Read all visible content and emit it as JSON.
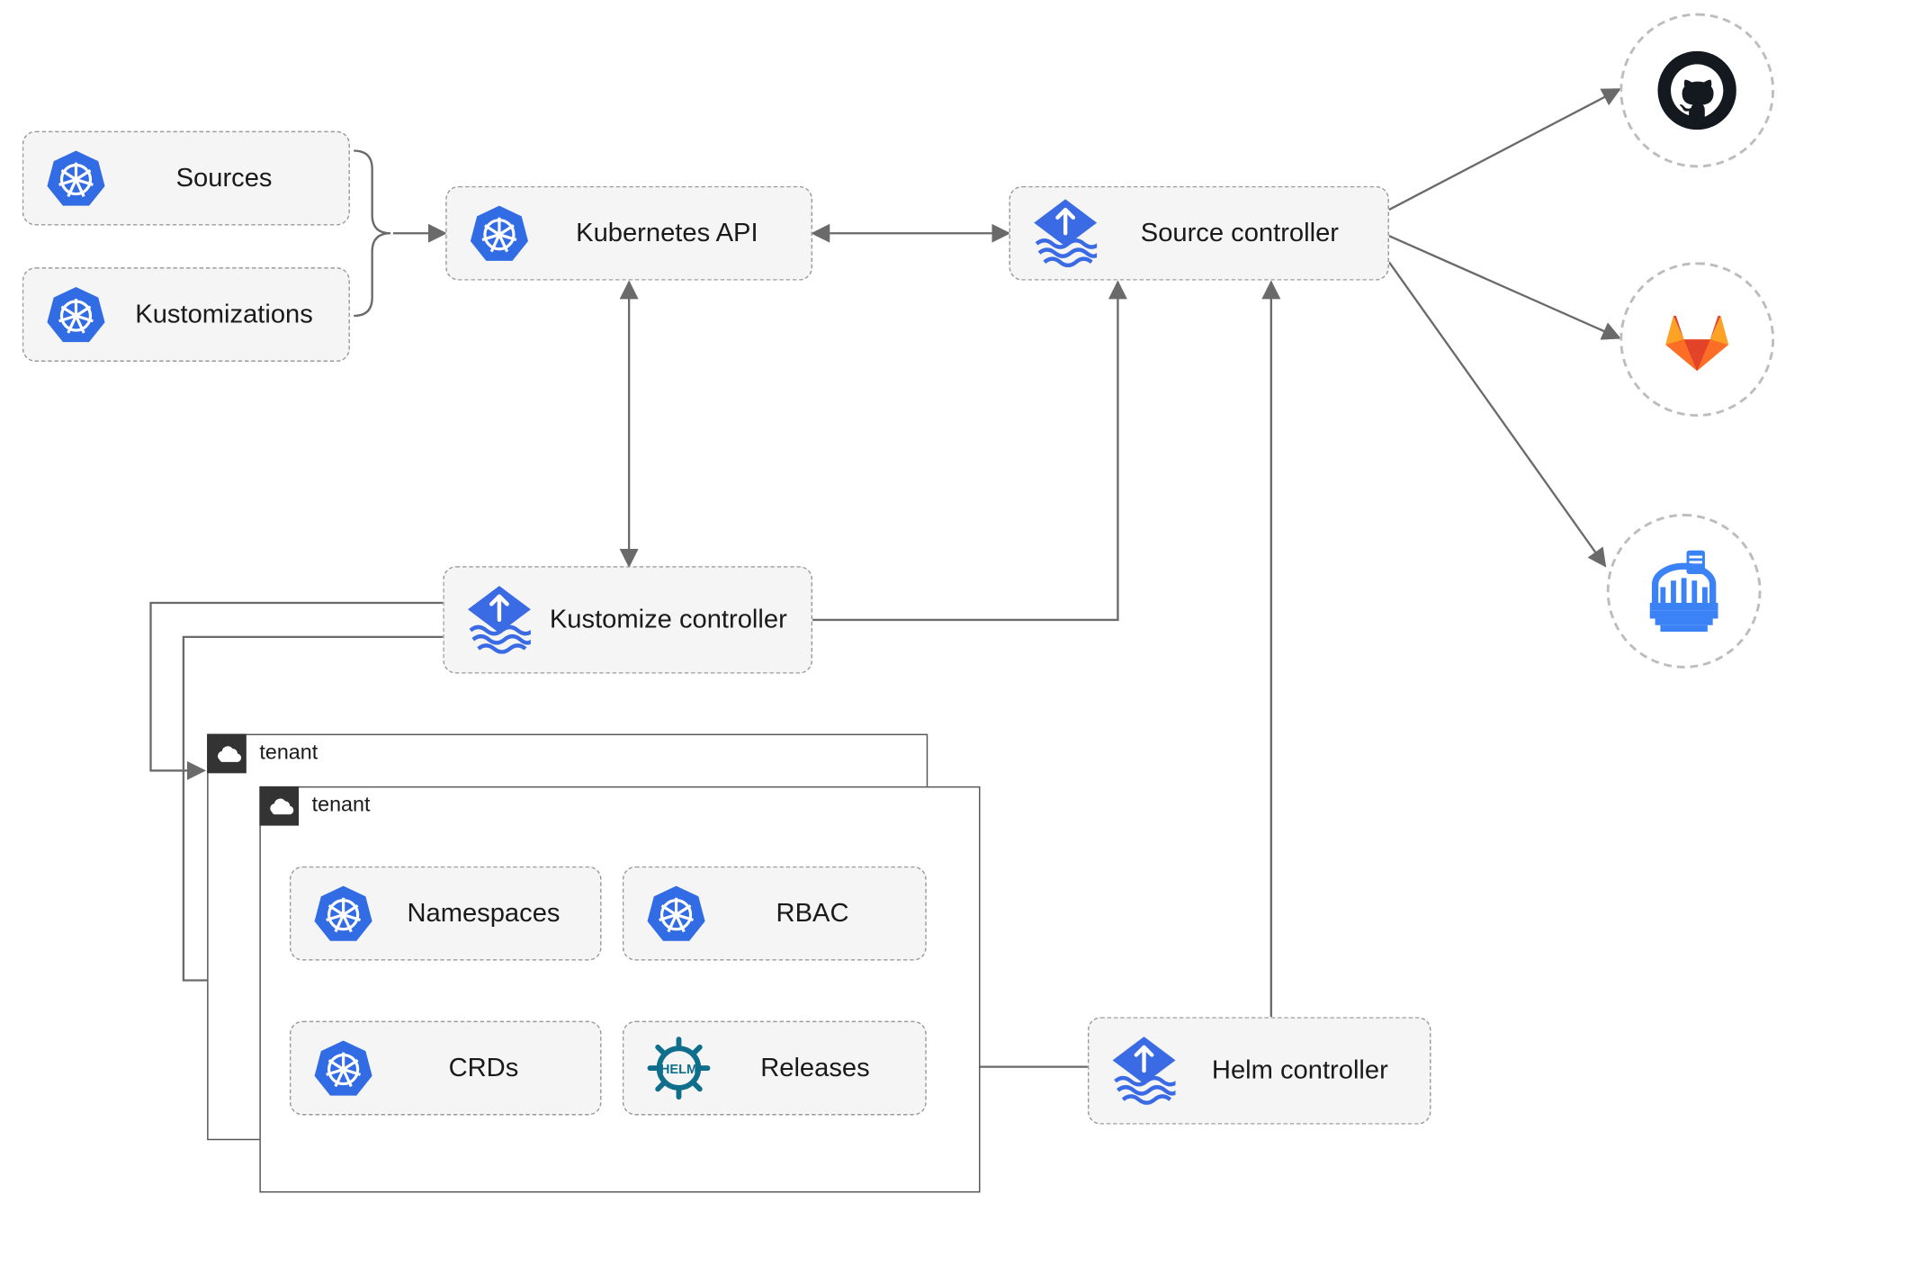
{
  "nodes": {
    "sources": "Sources",
    "kustomizations": "Kustomizations",
    "k8s_api": "Kubernetes API",
    "source_controller": "Source controller",
    "kustomize_controller": "Kustomize controller",
    "helm_controller": "Helm controller",
    "namespaces": "Namespaces",
    "rbac": "RBAC",
    "crds": "CRDs",
    "releases": "Releases"
  },
  "tenant_label": "tenant",
  "external": {
    "github": "github-icon",
    "gitlab": "gitlab-icon",
    "harbor": "harbor-icon"
  },
  "colors": {
    "node_bg": "#f5f5f5",
    "edge": "#6a6a6a",
    "k8s_blue": "#326ce5",
    "flux_blue": "#3a6be5",
    "helm_teal": "#0f6e8b",
    "github": "#14191f",
    "gitlab_orange": "#fc6d26",
    "gitlab_deep": "#e24329",
    "harbor_blue": "#3b82f6"
  },
  "edges": [
    {
      "from": "sources-kustomizations-brace",
      "to": "k8s_api",
      "type": "arrow"
    },
    {
      "from": "k8s_api",
      "to": "source_controller",
      "type": "double"
    },
    {
      "from": "k8s_api",
      "to": "kustomize_controller",
      "type": "double"
    },
    {
      "from": "kustomize_controller",
      "to": "source_controller",
      "type": "arrow"
    },
    {
      "from": "kustomize_controller",
      "to": "tenant1",
      "type": "arrow"
    },
    {
      "from": "kustomize_controller",
      "to": "tenant2",
      "type": "arrow"
    },
    {
      "from": "helm_controller",
      "to": "releases",
      "type": "arrow"
    },
    {
      "from": "helm_controller",
      "to": "source_controller",
      "type": "arrow"
    },
    {
      "from": "source_controller",
      "to": "github",
      "type": "arrow"
    },
    {
      "from": "source_controller",
      "to": "gitlab",
      "type": "arrow"
    },
    {
      "from": "source_controller",
      "to": "harbor",
      "type": "arrow"
    }
  ]
}
